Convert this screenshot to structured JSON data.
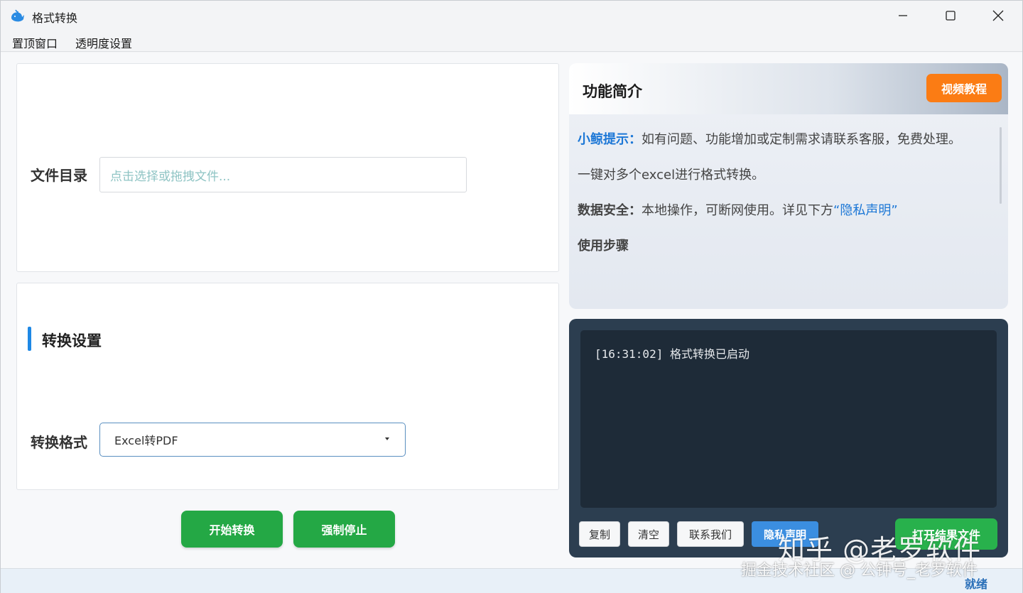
{
  "window": {
    "title": "格式转换",
    "minimize_icon": "minimize-icon",
    "maximize_icon": "maximize-icon",
    "close_icon": "close-icon"
  },
  "menu": {
    "items": [
      "置顶窗口",
      "透明度设置"
    ]
  },
  "file_section": {
    "label": "文件目录",
    "placeholder": "点击选择或拖拽文件..."
  },
  "convert_settings": {
    "title": "转换设置",
    "format_label": "转换格式",
    "format_value": "Excel转PDF"
  },
  "actions": {
    "start": "开始转换",
    "stop": "强制停止"
  },
  "intro": {
    "title": "功能简介",
    "video_button": "视频教程",
    "tip_label": "小鲸提示：",
    "tip_text": "如有问题、功能增加或定制需求请联系客服，免费处理。",
    "description": "一键对多个excel进行格式转换。",
    "security_label": "数据安全：",
    "security_text": "本地操作，可断网使用。详见下方",
    "privacy_link": "“隐私声明”",
    "steps_label": "使用步骤"
  },
  "log": {
    "lines": [
      "[16:31:02] 格式转换已启动"
    ],
    "copy_button": "复制",
    "clear_button": "清空",
    "contact_button": "联系我们",
    "privacy_button": "隐私声明",
    "open_result_button": "打开结果文件"
  },
  "status": {
    "text": "就绪"
  },
  "watermark": {
    "big": "知乎 @老罗软件",
    "small": "掘金技术社区 @ 公钟号_老罗软件"
  },
  "colors": {
    "accent_blue": "#1e88e5",
    "green": "#24a845",
    "orange": "#fb7c14",
    "log_bg": "#2c3e50"
  }
}
